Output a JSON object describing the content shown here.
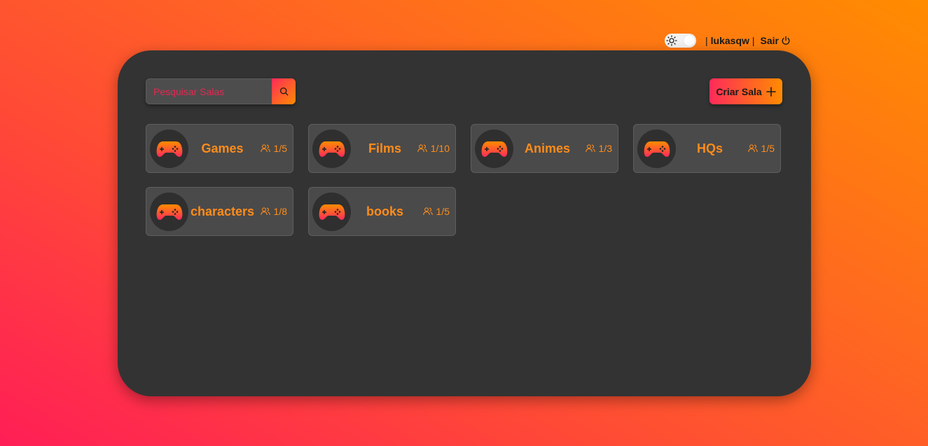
{
  "header": {
    "username": "lukasqw",
    "separator": "|",
    "logout_label": "Sair"
  },
  "search": {
    "placeholder": "Pesquisar Salas"
  },
  "create_room": {
    "label": "Criar Sala"
  },
  "colors": {
    "accent_start": "#ff2a5a",
    "accent_end": "#ff8c00",
    "panel": "#333333",
    "card": "#4a4a4a",
    "card_text": "#ff8c1a"
  },
  "rooms": [
    {
      "name": "Games",
      "count": "1/5",
      "icon": "gamepad-icon"
    },
    {
      "name": "Films",
      "count": "1/10",
      "icon": "gamepad-icon"
    },
    {
      "name": "Animes",
      "count": "1/3",
      "icon": "gamepad-icon"
    },
    {
      "name": "HQs",
      "count": "1/5",
      "icon": "gamepad-icon"
    },
    {
      "name": "characters",
      "count": "1/8",
      "icon": "gamepad-icon"
    },
    {
      "name": "books",
      "count": "1/5",
      "icon": "gamepad-icon"
    }
  ]
}
